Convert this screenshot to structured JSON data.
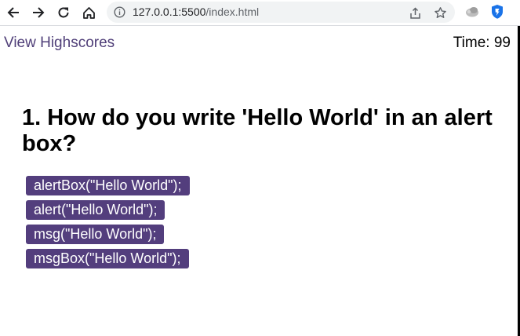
{
  "browser": {
    "url_host": "127.0.0.1:5500",
    "url_path": "/index.html",
    "icons": [
      "back-icon",
      "forward-icon",
      "reload-icon",
      "home-icon",
      "info-icon",
      "share-icon",
      "star-icon",
      "extension-icon",
      "shield-extension-icon"
    ]
  },
  "page": {
    "highscores_link": "View Highscores",
    "timer_label": "Time:",
    "timer_value": "99",
    "question": "1. How do you write 'Hello World' in an alert box?",
    "answers": [
      "alertBox(\"Hello World\");",
      "alert(\"Hello World\");",
      "msg(\"Hello World\");",
      "msgBox(\"Hello World\");"
    ],
    "colors": {
      "button_bg": "#533e7d",
      "link": "#4f3e78"
    }
  }
}
